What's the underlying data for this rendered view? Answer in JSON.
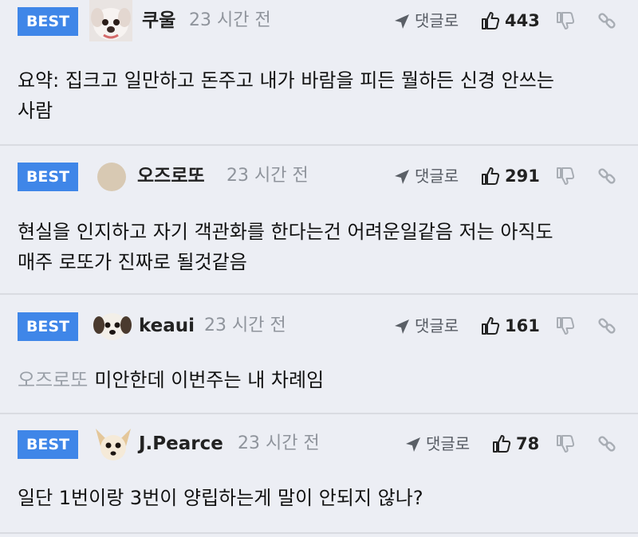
{
  "comments": [
    {
      "best": "BEST",
      "author": "쿠울",
      "time": "23 시간 전",
      "reply": "댓글로",
      "likes": "443",
      "text_lines": [
        "요약: 집크고 일만하고 돈주고 내가 바람을 피든 뭘하든 신경 안쓰는",
        "사람"
      ],
      "avatar_icon": "white-dog-avatar"
    },
    {
      "best": "BEST",
      "author": "오즈로또",
      "time": "23 시간 전",
      "reply": "댓글로",
      "likes": "291",
      "text_lines": [
        "현실을 인지하고 자기 객관화를 한다는건 어려운일같음 저는 아직도",
        "매주 로또가 진짜로 될것같음"
      ],
      "avatar_icon": "beige-circle-avatar"
    },
    {
      "best": "BEST",
      "author": "keaui",
      "time": "23 시간 전",
      "reply": "댓글로",
      "likes": "161",
      "mention": "오즈로또",
      "text_lines": [
        "미안한데 이번주는 내 차례임"
      ],
      "avatar_icon": "puppy-avatar"
    },
    {
      "best": "BEST",
      "author": "J.Pearce",
      "time": "23 시간 전",
      "reply": "댓글로",
      "likes": "78",
      "text_lines": [
        "일단 1번이랑 3번이 양립하는게 말이 안되지 않나?"
      ],
      "avatar_icon": "chihuahua-avatar"
    }
  ],
  "colors": {
    "background": "#eceef4",
    "best_badge": "#3f86e8",
    "muted": "#8f949c"
  }
}
